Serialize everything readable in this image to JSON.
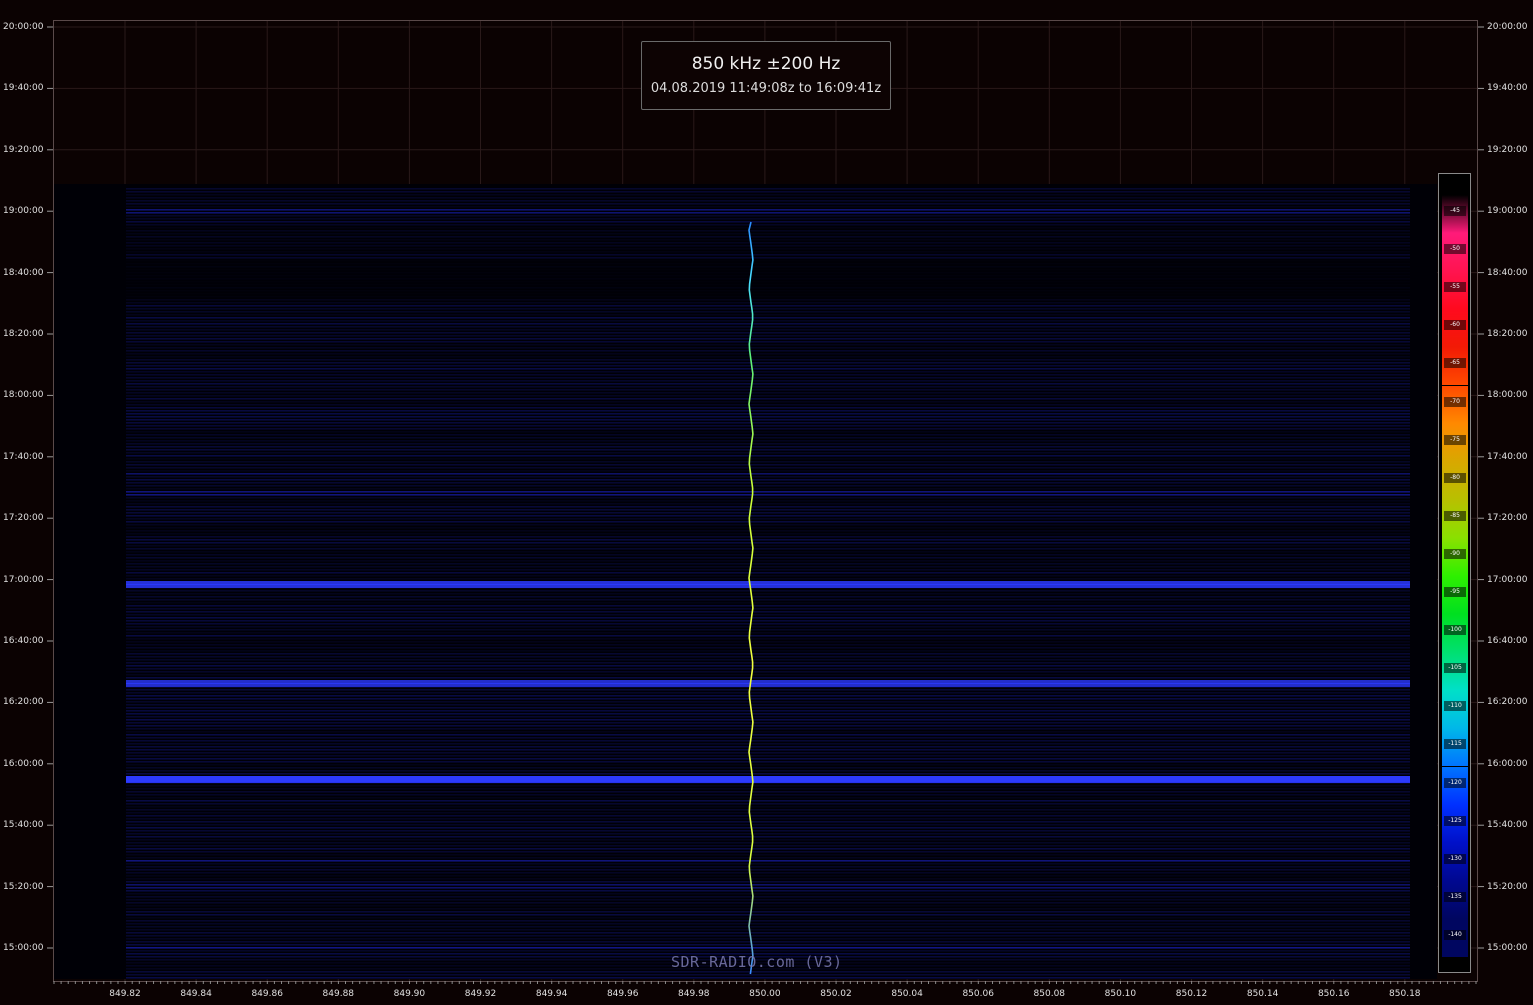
{
  "title_box": {
    "frequency": "850 kHz ±200 Hz",
    "time_range": "04.08.2019 11:49:08z to 16:09:41z"
  },
  "watermark": "SDR-RADIO.com (V3)",
  "time_axis": [
    "20:00:00",
    "19:40:00",
    "19:20:00",
    "19:00:00",
    "18:40:00",
    "18:20:00",
    "18:00:00",
    "17:40:00",
    "17:20:00",
    "17:00:00",
    "16:40:00",
    "16:20:00",
    "16:00:00",
    "15:40:00",
    "15:20:00",
    "15:00:00"
  ],
  "frequency_axis": [
    "849.82",
    "849.84",
    "849.86",
    "849.88",
    "849.90",
    "849.92",
    "849.94",
    "849.96",
    "849.98",
    "850.00",
    "850.02",
    "850.04",
    "850.06",
    "850.08",
    "850.10",
    "850.12",
    "850.14",
    "850.16",
    "850.18"
  ],
  "colorbar": {
    "levels": [
      "-45",
      "-50",
      "-55",
      "-60",
      "-65",
      "-70",
      "-75",
      "-80",
      "-85",
      "-90",
      "-95",
      "-100",
      "-105",
      "-110",
      "-115",
      "-120",
      "-125",
      "-130",
      "-135",
      "-140"
    ],
    "colors": [
      "#000000",
      "#ff1a7a",
      "#ff1450",
      "#ff0a1e",
      "#f21a05",
      "#ff4a00",
      "#ff8a00",
      "#d8a800",
      "#b8c000",
      "#8ae000",
      "#2ef000",
      "#00e020",
      "#00e070",
      "#00e0c8",
      "#00b8e8",
      "#0074ff",
      "#0030ff",
      "#0010c8",
      "#000890",
      "#000660"
    ]
  },
  "colors": {
    "background": "#0b0202",
    "trace": "#d9ff40",
    "noise": "#1e2ad6"
  }
}
